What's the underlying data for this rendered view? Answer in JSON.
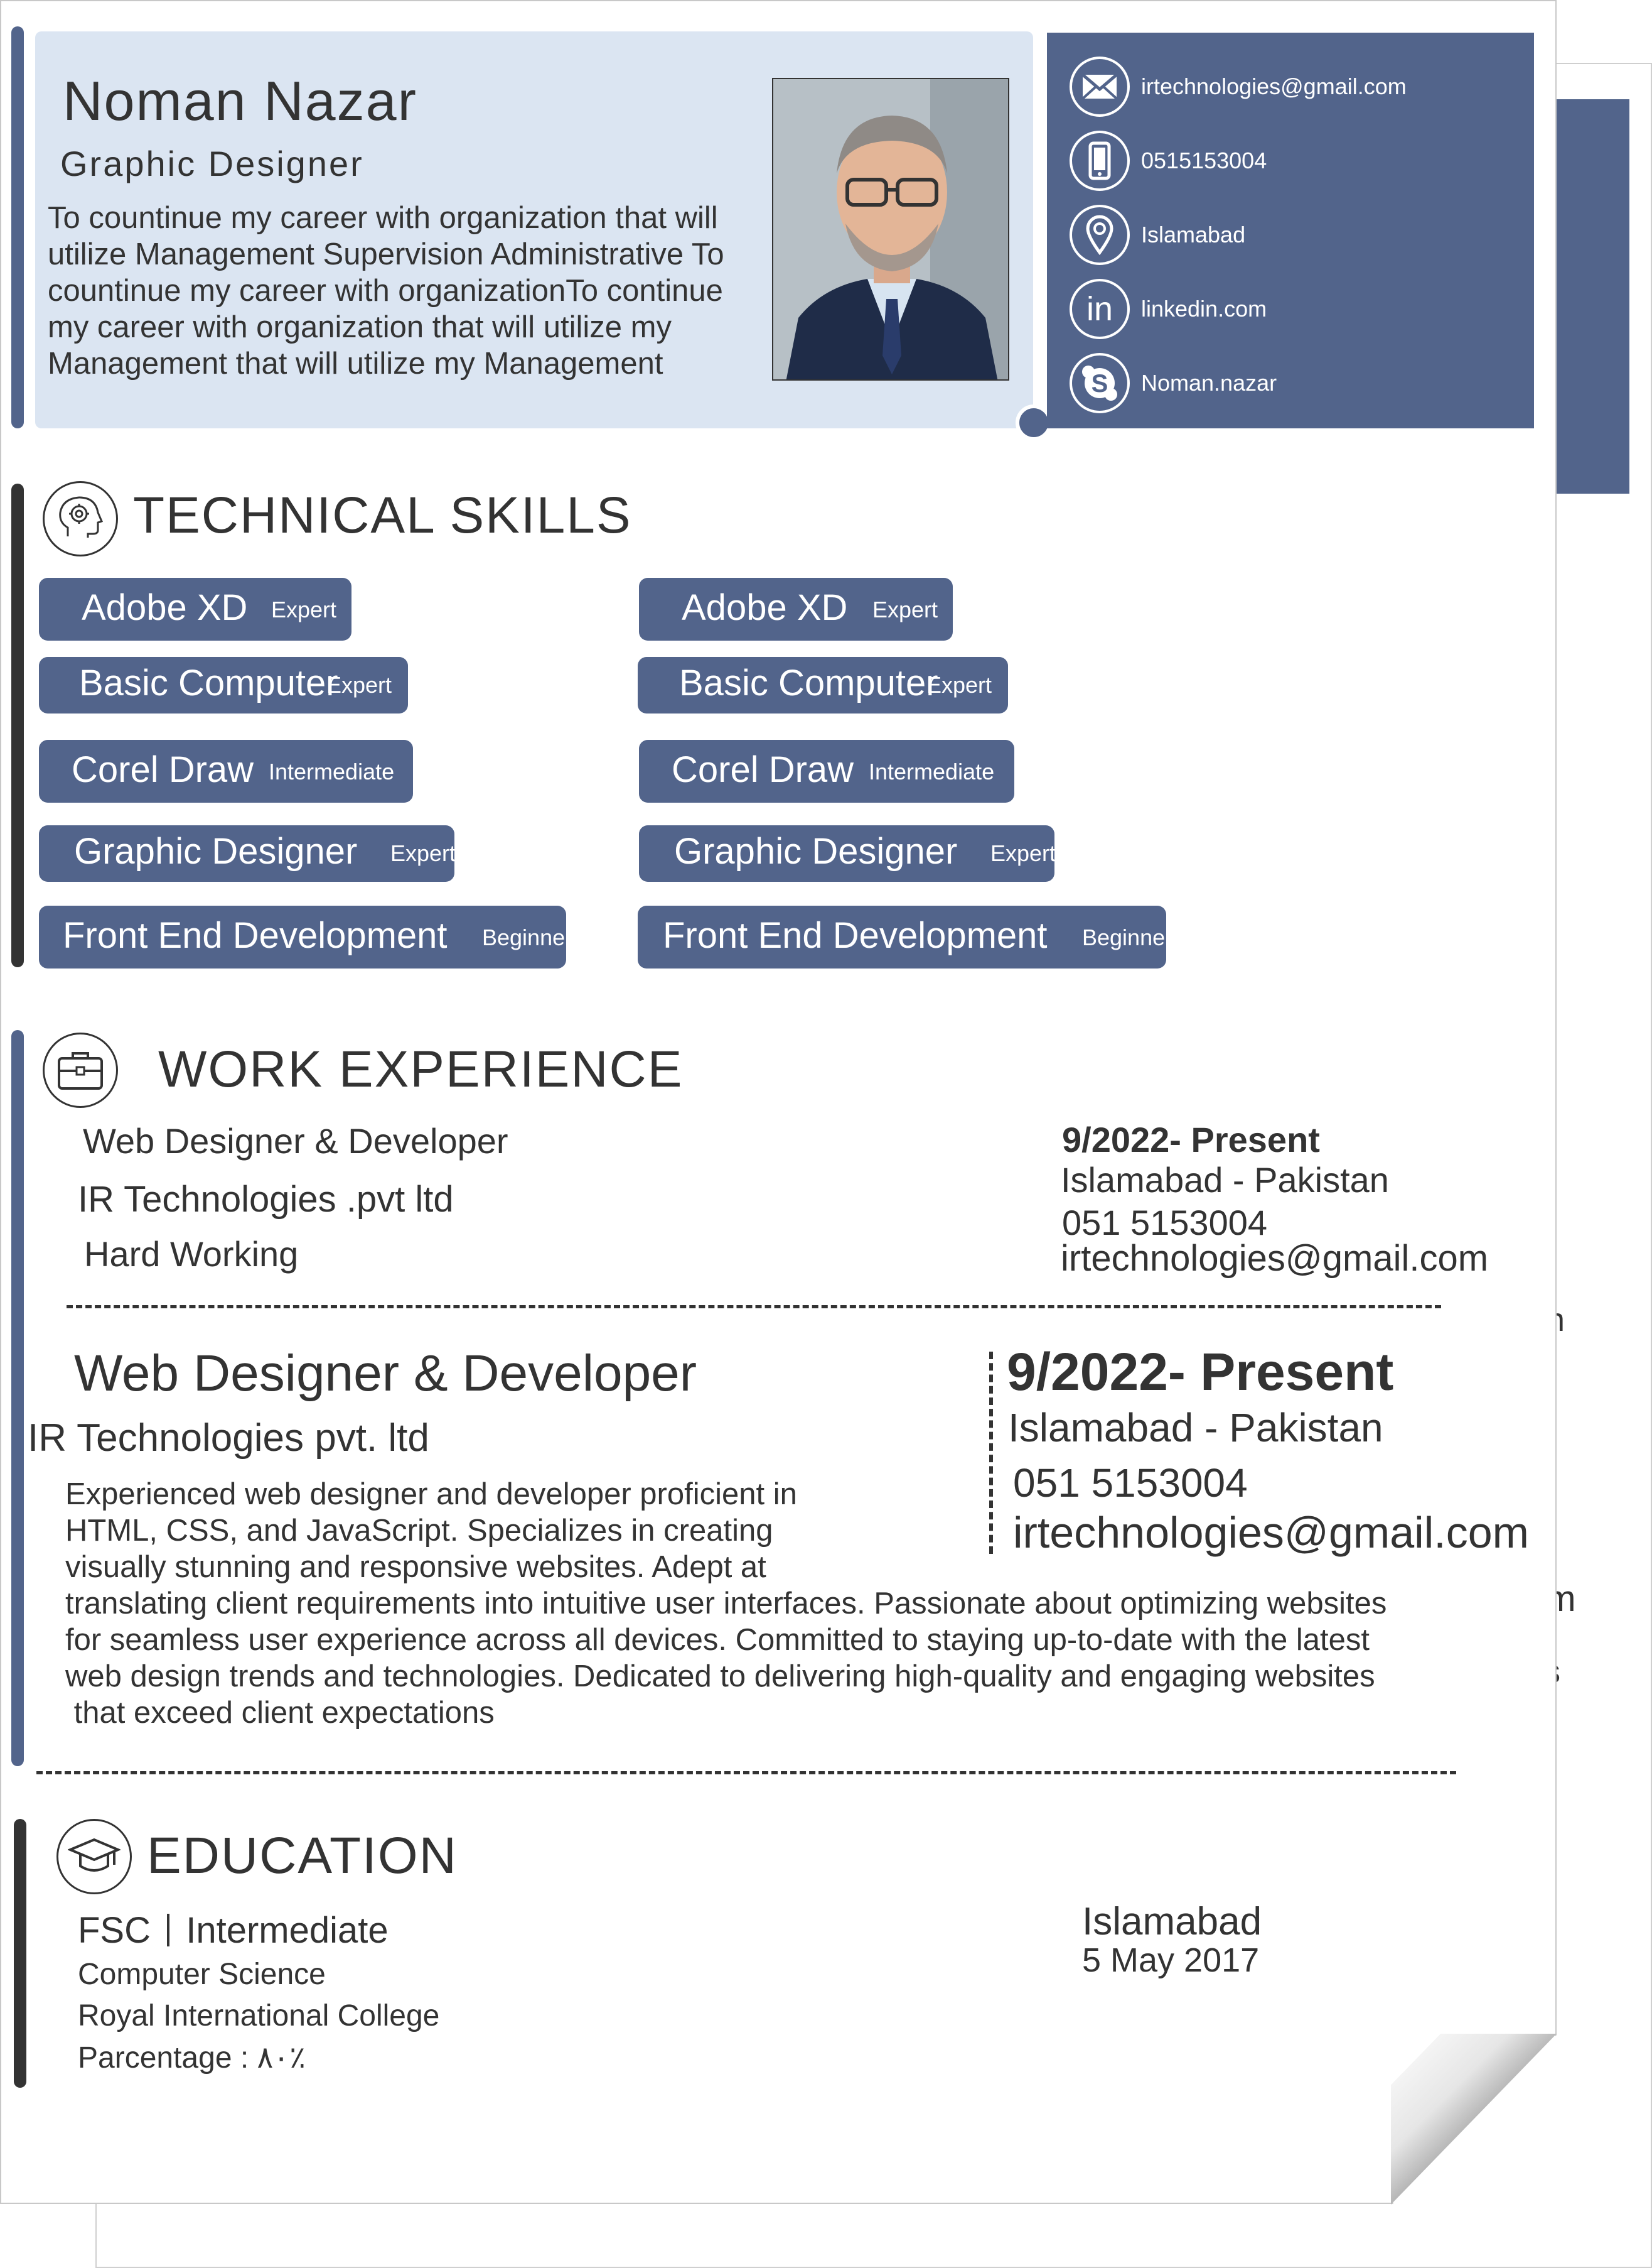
{
  "colors": {
    "accent": "#52648b",
    "panel": "#dbe5f2",
    "text": "#333333"
  },
  "profile": {
    "name": "Noman Nazar",
    "role": "Graphic  Designer",
    "objective": "To  countinue my career with organization that will utilize Management Supervision Administrative To countinue my career with organizationTo continue my career with organization that will utilize my Management that will utilize my Management"
  },
  "contact": {
    "email": "irtechnologies@gmail.com",
    "phone": "0515153004",
    "location": "Islamabad",
    "linkedin": "linkedin.com",
    "skype": "Noman.nazar",
    "icons": [
      "mail-icon",
      "phone-icon",
      "location-pin-icon",
      "linkedin-icon",
      "skype-icon"
    ]
  },
  "skills_section": {
    "title": "TECHNICAL SKILLS",
    "icon": "brain-gear-icon",
    "columns": [
      [
        {
          "name": "Adobe XD",
          "level": "Expert"
        },
        {
          "name": "Basic Computer",
          "level": "Expert"
        },
        {
          "name": "Corel Draw",
          "level": "Intermediate"
        },
        {
          "name": "Graphic Designer",
          "level": "Expert"
        },
        {
          "name": "Front End  Development",
          "level": "Beginner"
        }
      ],
      [
        {
          "name": "Adobe XD",
          "level": "Expert"
        },
        {
          "name": "Basic Computer",
          "level": "Expert"
        },
        {
          "name": "Corel Draw",
          "level": "Intermediate"
        },
        {
          "name": "Graphic Designer",
          "level": "Expert"
        },
        {
          "name": "Front End  Development",
          "level": "Beginner"
        }
      ]
    ]
  },
  "work_section": {
    "title": "WORK   EXPERIENCE",
    "icon": "briefcase-icon",
    "job1": {
      "title": "Web Designer & Developer",
      "company": "IR  Technologies  .pvt  ltd",
      "note": "Hard Working",
      "date": "9/2022- Present",
      "location": "Islamabad - Pakistan",
      "phone": "051 5153004",
      "email": "irtechnologies@gmail.com"
    },
    "job2": {
      "title": "Web Designer & Developer",
      "company": "IR Technologies pvt. ltd",
      "description_lines": [
        "Experienced web designer and developer proficient in",
        "HTML, CSS, and JavaScript. Specializes in creating",
        "visually stunning and responsive websites. Adept at",
        "translating client requirements into intuitive user interfaces. Passionate about optimizing websites",
        "for seamless user experience across all devices. Committed to staying up-to-date with the latest",
        "web design trends and technologies. Dedicated to delivering high-quality and engaging websites",
        " that exceed client expectations"
      ],
      "date": "9/2022- Present",
      "location": "Islamabad - Pakistan",
      "phone": "051 5153004",
      "email": "irtechnologies@gmail.com"
    }
  },
  "education_section": {
    "title": "EDUCATION",
    "icon": "graduation-cap-icon",
    "degree": "FSC",
    "level": "Intermediate",
    "field": "Computer Science",
    "college": "Royal International College",
    "percentage": "Parcentage : ۸۰٪",
    "city": "Islamabad",
    "date": "5 May 2017"
  },
  "back_page": {
    "fragments": [
      "n",
      "om",
      "s"
    ]
  }
}
